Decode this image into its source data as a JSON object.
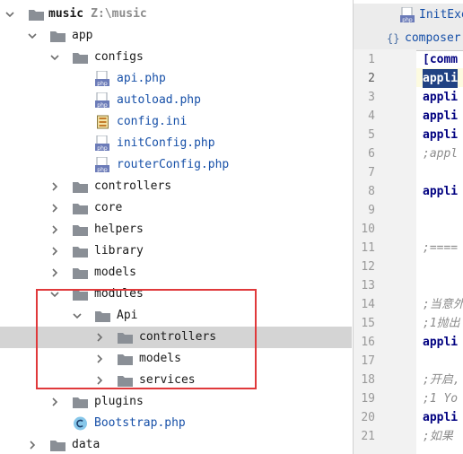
{
  "tree": {
    "root": {
      "name": "music",
      "path": "Z:\\music"
    },
    "items": [
      {
        "label": "app",
        "type": "folder",
        "expanded": true
      },
      {
        "label": "configs",
        "type": "folder",
        "expanded": true
      },
      {
        "label": "api.php",
        "type": "php"
      },
      {
        "label": "autoload.php",
        "type": "php"
      },
      {
        "label": "config.ini",
        "type": "ini"
      },
      {
        "label": "initConfig.php",
        "type": "php"
      },
      {
        "label": "routerConfig.php",
        "type": "php"
      },
      {
        "label": "controllers",
        "type": "folder",
        "expanded": false
      },
      {
        "label": "core",
        "type": "folder",
        "expanded": false
      },
      {
        "label": "helpers",
        "type": "folder",
        "expanded": false
      },
      {
        "label": "library",
        "type": "folder",
        "expanded": false
      },
      {
        "label": "models",
        "type": "folder",
        "expanded": false
      },
      {
        "label": "modules",
        "type": "folder",
        "expanded": true
      },
      {
        "label": "Api",
        "type": "folder",
        "expanded": true
      },
      {
        "label": "controllers",
        "type": "folder",
        "expanded": false,
        "selected": true
      },
      {
        "label": "models",
        "type": "folder",
        "expanded": false
      },
      {
        "label": "services",
        "type": "folder",
        "expanded": false
      },
      {
        "label": "plugins",
        "type": "folder",
        "expanded": false
      },
      {
        "label": "Bootstrap.php",
        "type": "class"
      },
      {
        "label": "data",
        "type": "folder",
        "expanded": false
      }
    ],
    "php_badge": "php"
  },
  "editor": {
    "tabs": [
      {
        "label": "InitExe",
        "icon": "php-file-icon"
      },
      {
        "label": "composer",
        "icon": "json-file-icon"
      }
    ],
    "line_numbers": [
      "1",
      "2",
      "3",
      "4",
      "5",
      "6",
      "7",
      "8",
      "9",
      "10",
      "11",
      "12",
      "13",
      "14",
      "15",
      "16",
      "17",
      "18",
      "19",
      "20",
      "21"
    ],
    "current_line": "2",
    "code": [
      {
        "line": "1",
        "text": "[comm",
        "style": "kw"
      },
      {
        "line": "2",
        "text": "appli",
        "style": "sel"
      },
      {
        "line": "3",
        "text": "appli",
        "style": "kw"
      },
      {
        "line": "4",
        "text": "appli",
        "style": "kw"
      },
      {
        "line": "5",
        "text": "appli",
        "style": "kw"
      },
      {
        "line": "6",
        "text": ";appl",
        "style": "cmt"
      },
      {
        "line": "8",
        "text": "appli",
        "style": "kw"
      },
      {
        "line": "11",
        "text": ";====",
        "style": "cmt"
      },
      {
        "line": "14",
        "text": ";当意外",
        "style": "cmt"
      },
      {
        "line": "15",
        "text": ";1抛出",
        "style": "cmt"
      },
      {
        "line": "16",
        "text": "appli",
        "style": "kw"
      },
      {
        "line": "18",
        "text": ";开启,",
        "style": "cmt"
      },
      {
        "line": "19",
        "text": ";1 Yo",
        "style": "cmt"
      },
      {
        "line": "20",
        "text": "appli",
        "style": "kw"
      },
      {
        "line": "21",
        "text": ";如果",
        "style": "cmt"
      }
    ]
  },
  "colors": {
    "selection_row": "#d4d4d4",
    "annotation_box": "#e0393b",
    "file_link": "#1750a8",
    "folder": "#8a8f96"
  }
}
